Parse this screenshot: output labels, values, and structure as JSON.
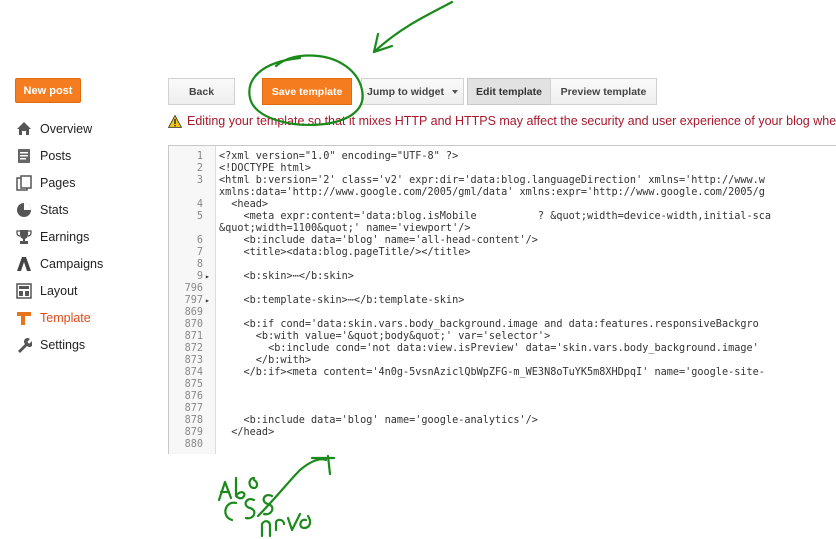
{
  "sidebar": {
    "new_post": "New post",
    "items": [
      {
        "label": "Overview",
        "icon": "home-icon"
      },
      {
        "label": "Posts",
        "icon": "posts-icon"
      },
      {
        "label": "Pages",
        "icon": "pages-icon"
      },
      {
        "label": "Stats",
        "icon": "stats-icon"
      },
      {
        "label": "Earnings",
        "icon": "trophy-icon"
      },
      {
        "label": "Campaigns",
        "icon": "campaigns-icon"
      },
      {
        "label": "Layout",
        "icon": "layout-icon"
      },
      {
        "label": "Template",
        "icon": "template-icon",
        "active": true
      },
      {
        "label": "Settings",
        "icon": "wrench-icon"
      }
    ]
  },
  "toolbar": {
    "back": "Back",
    "save": "Save template",
    "jump": "Jump to widget",
    "edit": "Edit template",
    "preview": "Preview template"
  },
  "warning": "Editing your template so that it mixes HTTP and HTTPS may affect the security and user experience of your blog when it",
  "editor": {
    "lines": [
      {
        "n": "1",
        "text": "<?xml version=\"1.0\" encoding=\"UTF-8\" ?>"
      },
      {
        "n": "2",
        "text": "<!DOCTYPE html>"
      },
      {
        "n": "3",
        "text": "<html b:version='2' class='v2' expr:dir='data:blog.languageDirection' xmlns='http://www.w"
      },
      {
        "n": "",
        "text": "xmlns:data='http://www.google.com/2005/gml/data' xmlns:expr='http://www.google.com/2005/g"
      },
      {
        "n": "4",
        "text": "  <head>"
      },
      {
        "n": "5",
        "text": "    <meta expr:content='data:blog.isMobile          ? &quot;width=device-width,initial-sca"
      },
      {
        "n": "",
        "text": "&quot;width=1100&quot;' name='viewport'/>"
      },
      {
        "n": "6",
        "text": "    <b:include data='blog' name='all-head-content'/>"
      },
      {
        "n": "7",
        "text": "    <title><data:blog.pageTitle/></title>"
      },
      {
        "n": "8",
        "text": ""
      },
      {
        "n": "9",
        "fold": "▸",
        "text": "    <b:skin>⋯</b:skin>"
      },
      {
        "n": "796",
        "text": ""
      },
      {
        "n": "797",
        "fold": "▸",
        "text": "    <b:template-skin>⋯</b:template-skin>"
      },
      {
        "n": "869",
        "text": ""
      },
      {
        "n": "870",
        "text": "    <b:if cond='data:skin.vars.body_background.image and data:features.responsiveBackgro"
      },
      {
        "n": "871",
        "text": "      <b:with value='&quot;body&quot;' var='selector'>"
      },
      {
        "n": "872",
        "text": "        <b:include cond='not data:view.isPreview' data='skin.vars.body_background.image'"
      },
      {
        "n": "873",
        "text": "      </b:with>"
      },
      {
        "n": "874",
        "text": "    </b:if><meta content='4n0g-5vsnAziclQbWpZFG-m_WE3N8oTuYK5m8XHDpqI' name='google-site-"
      },
      {
        "n": "875",
        "text": ""
      },
      {
        "n": "876",
        "text": ""
      },
      {
        "n": "877",
        "text": ""
      },
      {
        "n": "878",
        "text": "    <b:include data='blog' name='google-analytics'/>"
      },
      {
        "n": "879",
        "text": "  </head>"
      },
      {
        "n": "880",
        "text": ""
      }
    ]
  },
  "annotation": {
    "color": "#1a8a1a"
  }
}
